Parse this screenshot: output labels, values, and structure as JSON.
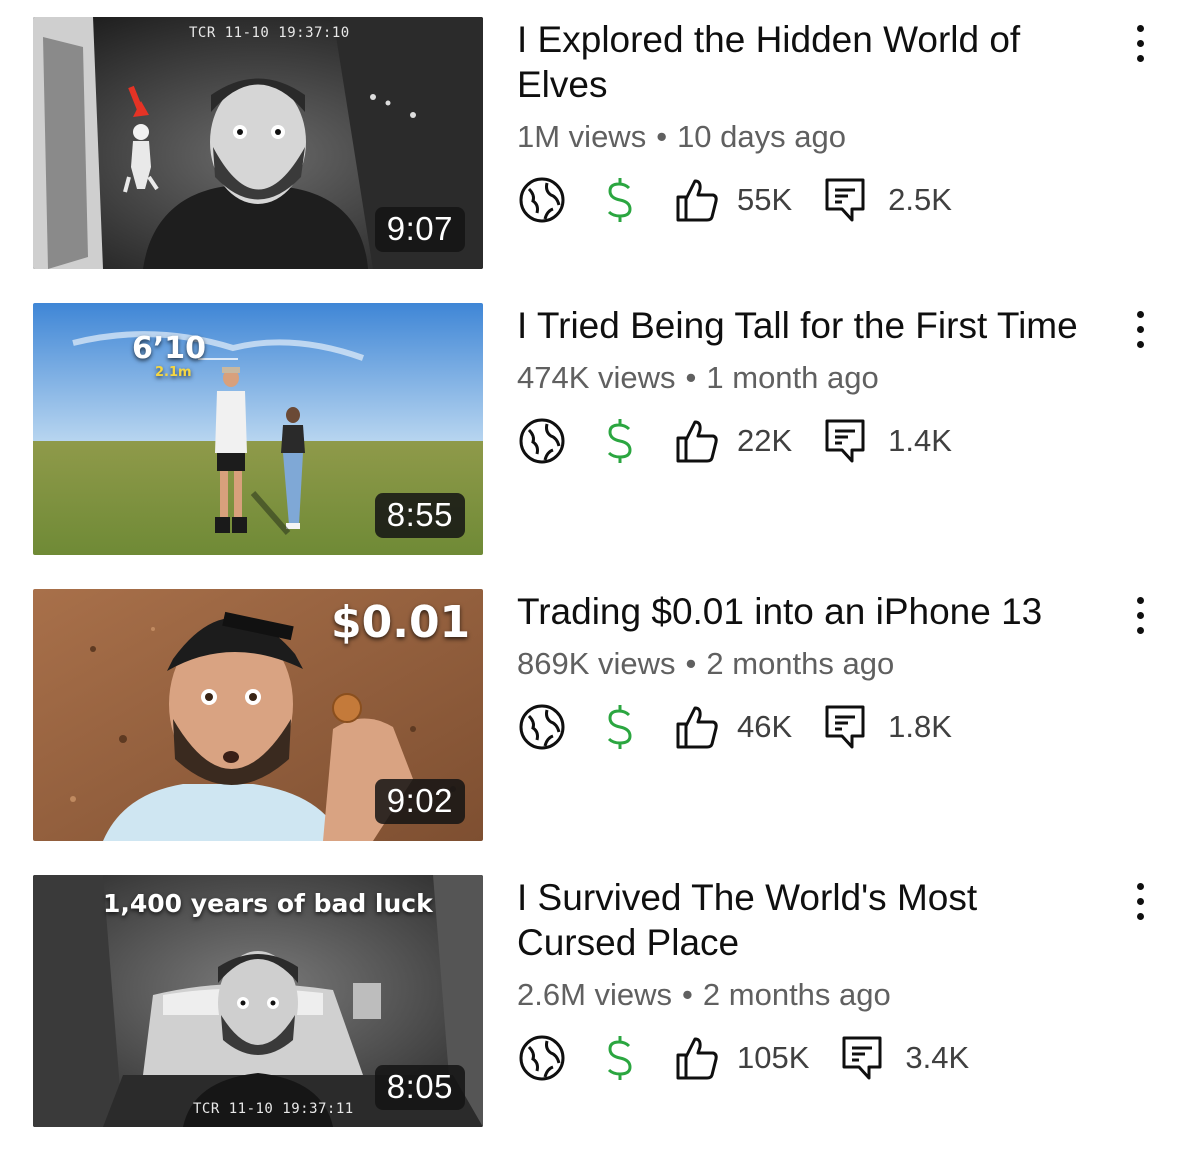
{
  "videos": [
    {
      "title": "I Explored the Hidden World of Elves",
      "views": "1M views",
      "age": "10 days ago",
      "duration": "9:07",
      "likes": "55K",
      "comments": "2.5K",
      "overlay_text": "TCR 11-10 19:37:10",
      "thumb_icon": "night-vision-doorway-thumbnail"
    },
    {
      "title": "I Tried Being Tall for the First Time",
      "views": "474K views",
      "age": "1 month ago",
      "duration": "8:55",
      "likes": "22K",
      "comments": "1.4K",
      "overlay_text": "6’10",
      "overlay_text_2": "2.1m",
      "thumb_icon": "field-two-people-thumbnail"
    },
    {
      "title": "Trading $0.01 into an iPhone 13",
      "views": "869K views",
      "age": "2 months ago",
      "duration": "9:02",
      "likes": "46K",
      "comments": "1.8K",
      "overlay_text": "$0.01",
      "thumb_icon": "man-holding-penny-thumbnail"
    },
    {
      "title": "I Survived The World's Most Cursed Place",
      "views": "2.6M views",
      "age": "2 months ago",
      "duration": "8:05",
      "likes": "105K",
      "comments": "3.4K",
      "overlay_text": "1,400 years of bad luck",
      "overlay_text_2": "TCR 11-10 19:37:11",
      "thumb_icon": "night-vision-bedroom-thumbnail"
    }
  ],
  "separator": "•",
  "icons": {
    "visibility": "globe-icon",
    "monetization": "dollar-icon",
    "likes": "thumbs-up-icon",
    "comments": "comment-icon",
    "menu": "more-vert-icon"
  },
  "colors": {
    "title": "#0f0f0f",
    "meta": "#606060",
    "monetization": "#2ba640",
    "duration_bg": "#141414"
  }
}
